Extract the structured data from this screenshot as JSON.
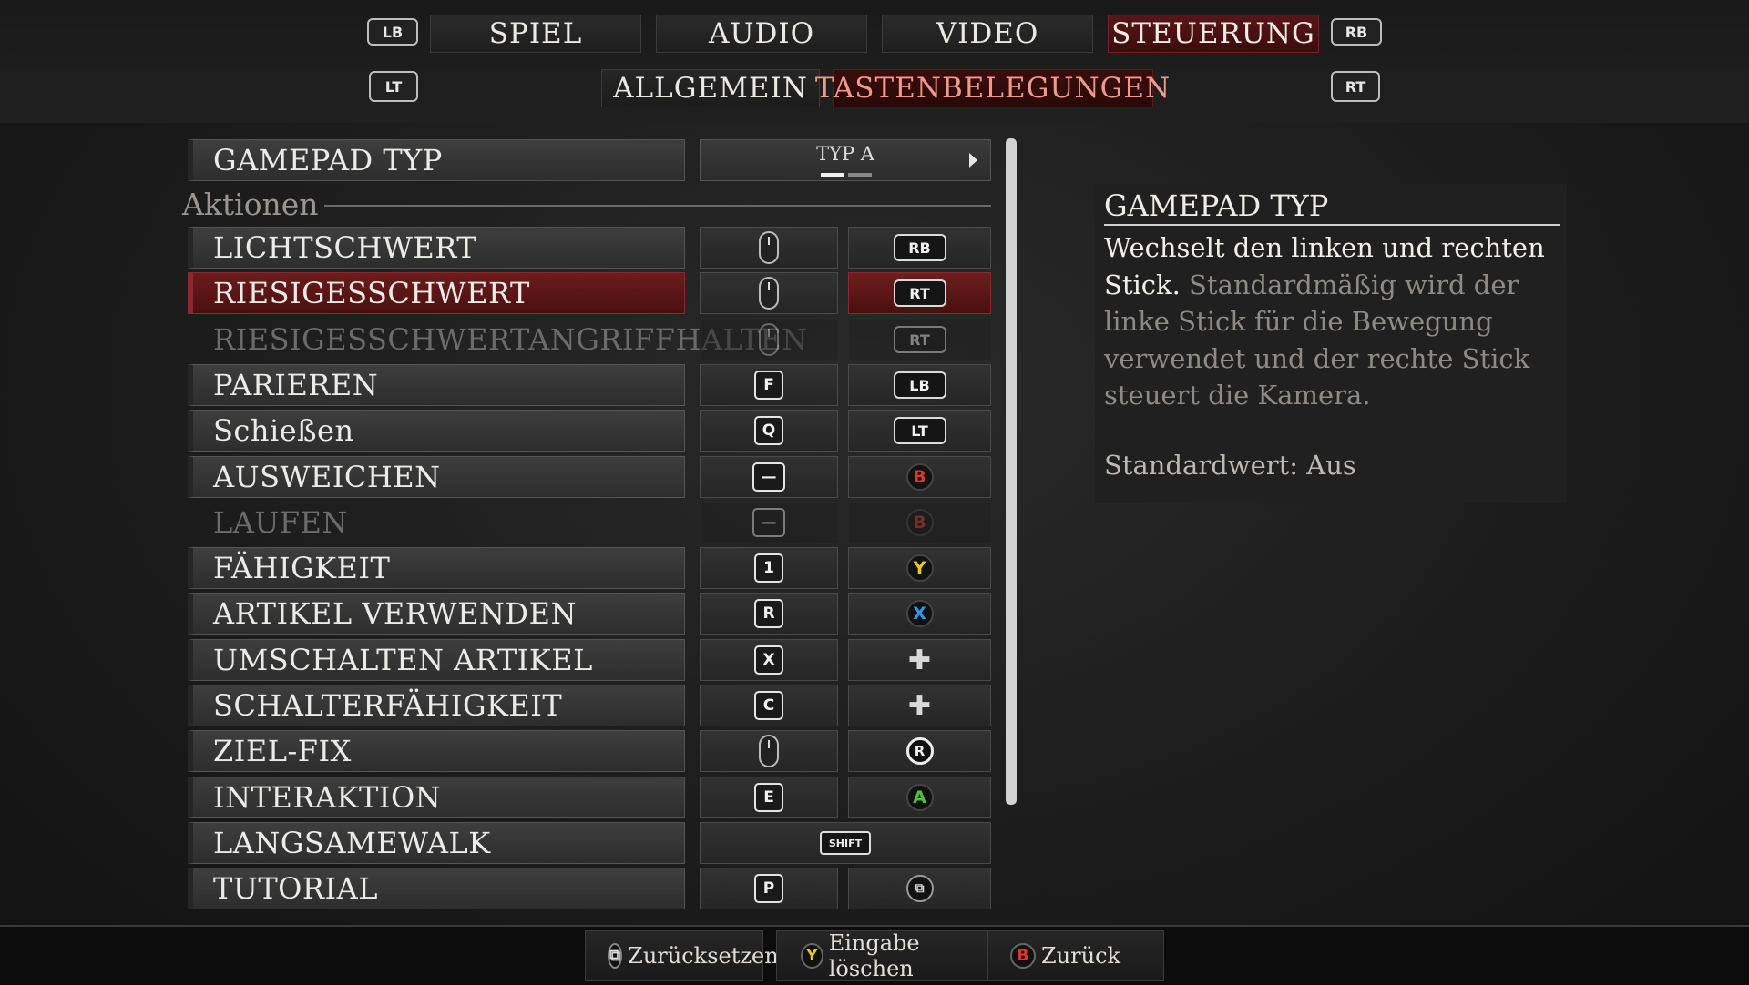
{
  "tabs": {
    "lb": "LB",
    "rb": "RB",
    "lt": "LT",
    "rt": "RT",
    "items": [
      "SPIEL",
      "AUDIO",
      "VIDEO",
      "STEUERUNG"
    ],
    "active": "STEUERUNG",
    "subtabs": [
      "ALLGEMEIN",
      "TASTENBELEGUNGEN"
    ],
    "active_subtab": "TASTENBELEGUNGEN"
  },
  "gamepad": {
    "label": "GAMEPAD TYP",
    "value": "TYP A"
  },
  "section": "Aktionen",
  "bindings": [
    {
      "label": "LICHTSCHWERT",
      "key": "mouse",
      "pad": "RB",
      "state": "normal"
    },
    {
      "label": "RIESIGESSCHWERT",
      "key": "mouse",
      "pad": "RT",
      "state": "active"
    },
    {
      "label": "RIESIGESSCHWERTANGRIFFHALTEN",
      "key": "mouse",
      "pad": "RT",
      "state": "disabled"
    },
    {
      "label": "PARIEREN",
      "key": "F",
      "pad": "LB",
      "state": "normal"
    },
    {
      "label": "Schießen",
      "key": "Q",
      "pad": "LT",
      "state": "normal"
    },
    {
      "label": "AUSWEICHEN",
      "key": "space",
      "pad": "B",
      "state": "normal"
    },
    {
      "label": "LAUFEN",
      "key": "space",
      "pad": "B",
      "state": "disabled"
    },
    {
      "label": "FÄHIGKEIT",
      "key": "1",
      "pad": "Y",
      "state": "normal"
    },
    {
      "label": "ARTIKEL VERWENDEN",
      "key": "R",
      "pad": "X",
      "state": "normal"
    },
    {
      "label": "UMSCHALTEN ARTIKEL",
      "key": "X",
      "pad": "dpad",
      "state": "normal"
    },
    {
      "label": "SCHALTERFÄHIGKEIT",
      "key": "C",
      "pad": "dpad",
      "state": "normal"
    },
    {
      "label": "ZIEL-FIX",
      "key": "mouse",
      "pad": "R-stick",
      "state": "normal"
    },
    {
      "label": "INTERAKTION",
      "key": "E",
      "pad": "A",
      "state": "normal"
    },
    {
      "label": "LANGSAMEWALK",
      "key": "SHIFT",
      "pad": "",
      "state": "normal"
    },
    {
      "label": "TUTORIAL",
      "key": "P",
      "pad": "view",
      "state": "normal"
    }
  ],
  "description": {
    "title": "GAMEPAD TYP",
    "highlight": "Wechselt den linken und rechten Stick.",
    "body": "Standardmäßig wird der linke Stick für die Bewegung verwendet und der rechte Stick steuert die Kamera.",
    "default": "Standardwert: Aus"
  },
  "footer": {
    "reset": "Zurücksetzen",
    "clear": "Eingabe löschen",
    "back": "Zurück",
    "reset_icon": "view-button-icon",
    "clear_icon": "Y",
    "back_icon": "B"
  },
  "colors": {
    "active_red": "#5a1616",
    "y": "#e8c81a",
    "b": "#e0352b",
    "x": "#2f9be8",
    "a": "#4cc23a"
  }
}
